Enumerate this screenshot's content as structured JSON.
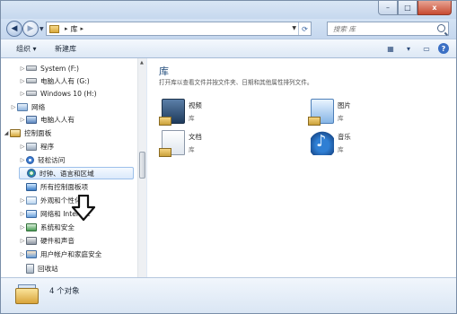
{
  "window": {
    "controls": {
      "minimize": "–",
      "maximize": "□",
      "close": "x"
    }
  },
  "address": {
    "crumbs": [
      "库"
    ],
    "separator": "▸",
    "search_placeholder": "搜索 库"
  },
  "toolbar": {
    "organize_label": "组织 ▾",
    "new_library_label": "新建库",
    "view_glyph": "▦",
    "view_drop": "▾",
    "pane_glyph": "▭",
    "help_glyph": "?"
  },
  "sidebar": {
    "items": [
      {
        "label": "System (F:)",
        "icon": "drive-icon",
        "expander": "▷"
      },
      {
        "label": "电脑人人有 (G:)",
        "icon": "drive-icon",
        "expander": "▷"
      },
      {
        "label": "Windows 10 (H:)",
        "icon": "drive-icon",
        "expander": "▷"
      },
      {
        "label": "网络",
        "icon": "network-icon",
        "expander": "▷"
      },
      {
        "label": "电脑人人有",
        "icon": "computer-icon",
        "expander": "▷"
      },
      {
        "label": "控制面板",
        "icon": "control-panel-icon",
        "expander": "◢"
      },
      {
        "label": "程序",
        "icon": "programs-icon",
        "expander": "▷"
      },
      {
        "label": "轻松访问",
        "icon": "ease-of-access-icon",
        "expander": "▷"
      },
      {
        "label": "时钟、语言和区域",
        "icon": "clock-language-region-icon",
        "expander": ""
      },
      {
        "label": "所有控制面板项",
        "icon": "all-control-panel-icon",
        "expander": ""
      },
      {
        "label": "外观和个性化",
        "icon": "appearance-icon",
        "expander": "▷"
      },
      {
        "label": "网络和 Internet",
        "icon": "network-internet-icon",
        "expander": "▷"
      },
      {
        "label": "系统和安全",
        "icon": "system-security-icon",
        "expander": "▷"
      },
      {
        "label": "硬件和声音",
        "icon": "hardware-sound-icon",
        "expander": "▷"
      },
      {
        "label": "用户帐户和家庭安全",
        "icon": "user-accounts-icon",
        "expander": "▷"
      },
      {
        "label": "回收站",
        "icon": "recycle-bin-icon",
        "expander": ""
      }
    ],
    "highlighted_index": 8,
    "annotation_arrow": "down-arrow-icon"
  },
  "content": {
    "title": "库",
    "subtitle": "打开库以查看文件并按文件夹、日期和其他属性排列文件。",
    "libraries": [
      {
        "name": "视频",
        "type": "库",
        "icon": "video-library-icon"
      },
      {
        "name": "图片",
        "type": "库",
        "icon": "pictures-library-icon"
      },
      {
        "name": "文档",
        "type": "库",
        "icon": "documents-library-icon"
      },
      {
        "name": "音乐",
        "type": "库",
        "icon": "music-library-icon"
      }
    ]
  },
  "details": {
    "count_text": "4 个对象"
  },
  "colors": {
    "title_blue": "#1e4a7a",
    "highlight_border": "#9cc0ea",
    "frame": "#dfe9f5"
  }
}
